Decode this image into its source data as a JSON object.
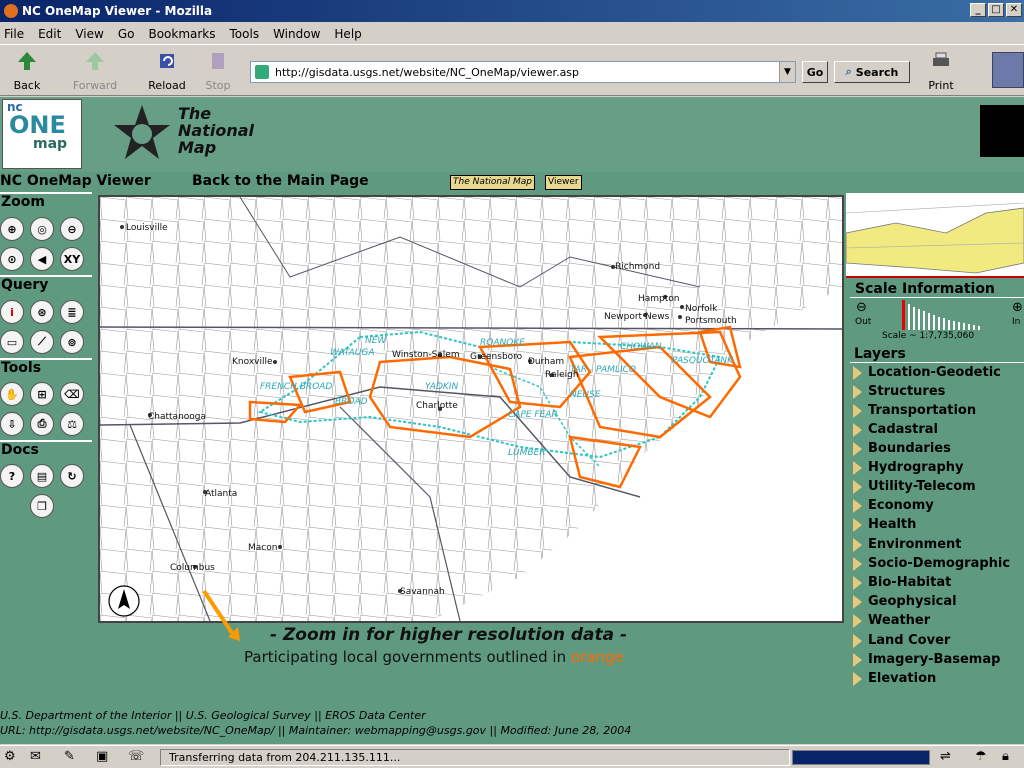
{
  "window": {
    "title": "NC OneMap Viewer - Mozilla"
  },
  "menu": [
    "File",
    "Edit",
    "View",
    "Go",
    "Bookmarks",
    "Tools",
    "Window",
    "Help"
  ],
  "toolbar": {
    "back": "Back",
    "forward": "Forward",
    "reload": "Reload",
    "stop": "Stop",
    "go": "Go",
    "search": "Search",
    "print": "Print"
  },
  "address": {
    "url": "http://gisdata.usgs.net/website/NC_OneMap/viewer.asp"
  },
  "header": {
    "nm_line1": "The",
    "nm_line2": "National",
    "nm_line3": "Map",
    "logo_line1": "nc",
    "logo_line2": "ONE",
    "logo_line3": "map"
  },
  "nav": {
    "viewer_title": "NC OneMap Viewer",
    "back_link": "Back to the Main Page",
    "tab1": "The National Map",
    "tab2": "Viewer"
  },
  "tools": {
    "zoom": "Zoom",
    "query": "Query",
    "tools": "Tools",
    "docs": "Docs",
    "xy": "XY"
  },
  "map": {
    "cities": [
      "Louisville",
      "Richmond",
      "Hampton",
      "Norfolk",
      "Newport News",
      "Portsmouth",
      "Knoxville",
      "Winston-Salem",
      "Greensboro",
      "Durham",
      "Raleigh",
      "Charlotte",
      "Chattanooga",
      "Atlanta",
      "Macon",
      "Columbus",
      "Savannah"
    ],
    "basins": [
      "ROANOKE",
      "CHOWAN",
      "NEW",
      "WATAUGA",
      "TAR - PAMLICO",
      "YADKIN",
      "BROAD",
      "FRENCH BROAD",
      "NEUSE",
      "CAPE FEAR",
      "LUMBER",
      "PASQUOTANK"
    ],
    "hint": "- Zoom in for higher resolution data -",
    "hint2_prefix": "Participating local governments outlined in ",
    "hint2_highlight": "orange",
    "colors": {
      "outline": "#ff6a00",
      "rivers": "#2ec4c4"
    }
  },
  "scale": {
    "title": "Scale Information",
    "out": "Out",
    "in": "In",
    "value": "Scale ~ 1:7,735,060"
  },
  "layers": {
    "title": "Layers",
    "items": [
      "Location-Geodetic",
      "Structures",
      "Transportation",
      "Cadastral",
      "Boundaries",
      "Hydrography",
      "Utility-Telecom",
      "Economy",
      "Health",
      "Environment",
      "Socio-Demographic",
      "Bio-Habitat",
      "Geophysical",
      "Weather",
      "Land Cover",
      "Imagery-Basemap",
      "Elevation"
    ]
  },
  "footer": {
    "line1": "U.S. Department of the Interior    ||    U.S. Geological Survey    ||    EROS Data Center",
    "line2": "URL: http://gisdata.usgs.net/website/NC_OneMap/    ||    Maintainer: webmapping@usgs.gov    ||    Modified: June 28, 2004"
  },
  "status": {
    "text": "Transferring data from 204.211.135.111..."
  }
}
